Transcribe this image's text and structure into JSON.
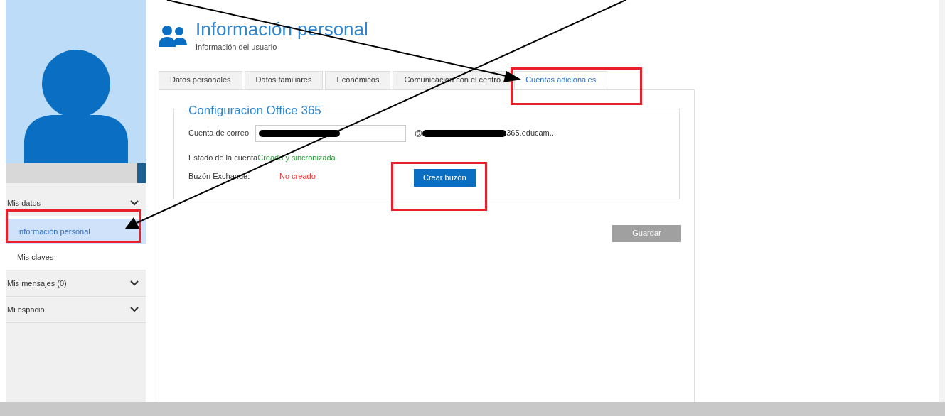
{
  "header": {
    "title": "Información personal",
    "subtitle": "Información del usuario"
  },
  "tabs": [
    {
      "label": "Datos personales",
      "selected": false
    },
    {
      "label": "Datos familiares",
      "selected": false
    },
    {
      "label": "Económicos",
      "selected": false
    },
    {
      "label": "Comunicación con el centro",
      "selected": false
    },
    {
      "label": "Cuentas adicionales",
      "selected": true
    }
  ],
  "section": {
    "legend": "Configuracion Office 365",
    "email_label": "Cuenta de correo:",
    "email_domain_prefix": "@",
    "email_domain_suffix": "365.educam...",
    "status_label": "Estado de la cuenta",
    "status_value": "Creada y sincronizada",
    "mailbox_label": "Buzón Exchange:",
    "mailbox_value": "No creado",
    "create_button": "Crear buzón"
  },
  "save_button": {
    "label": "Guardar",
    "disabled": true
  },
  "sidebar": {
    "groups": [
      {
        "label": "Mis datos",
        "expanded": true,
        "children": [
          {
            "label": "Información personal",
            "selected": true
          },
          {
            "label": "Mis claves",
            "selected": false
          }
        ]
      },
      {
        "label": "Mis mensajes (0)",
        "expanded": false
      },
      {
        "label": "Mi espacio",
        "expanded": false
      }
    ]
  }
}
